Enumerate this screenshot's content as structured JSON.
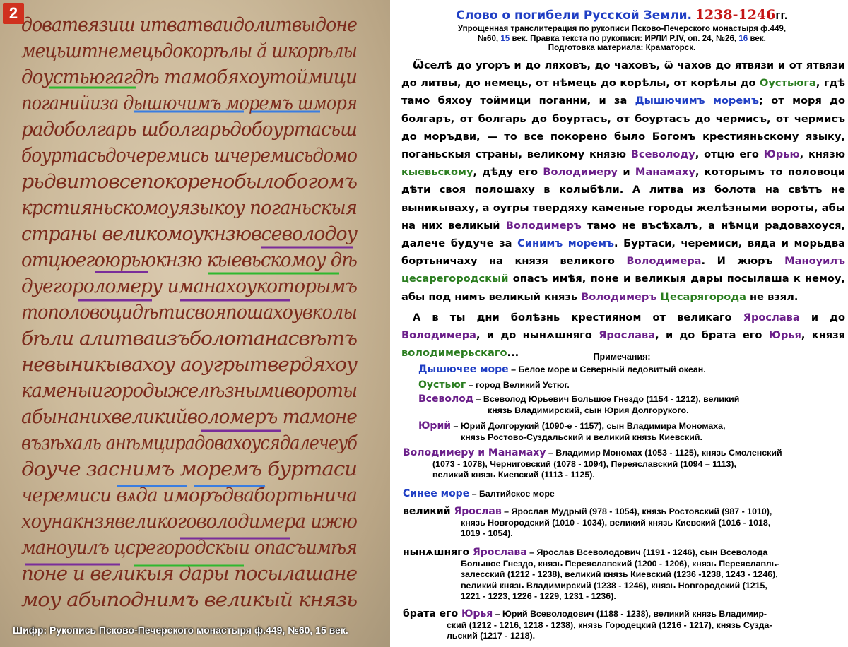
{
  "page_number": "2",
  "cipher": "Шифр: Рукопись Псково-Печерского монастыря ф.449, №60, 15 век.",
  "manuscript_lines": [
    "доватвязиш итватваидолитвыдоне",
    "мецьштнемецьдокорѣлы ӑ шкорѣлы",
    "доустьюгагдѣ тамобяхоутоймици",
    "поганийиза дышючимъ моремъ шморя",
    "радоболгарь шболгарьдобоуртасьш",
    "боуртасьдочеремись шчеремисьдомо",
    "рьдвитовсепокоренобылобогомъ",
    "крстияньскомоуязыкоу поганьскыя",
    "страны великомоукнзювсеволодоу",
    "отцюегоюрьюкнзю кыевьскомоу дѣ",
    "дуегороломеру иманахоукоторымъ",
    "тополовоцидѣтисвояпошахоувколы",
    "бѣли алитваизъболотанасвѣтъ",
    "невыникывахоу аоугрытвердяхоу",
    "каменыигородыжелѣзнымивороты",
    "абынанихвеликийволомеръ тамоне",
    "възѣхаль анѣмцирадовахоусядалечеуб",
    "доуче заснимъ моремъ буртаси",
    "черемиси вѧда иморъдвабортьнича",
    "хоунакнзявеликоговолодимера ижю",
    "маноуилъ цсрегородскыи опасъимѣя",
    "поне и великыя дары посылашане",
    "моу абыподнимъ великый князь",
    ""
  ],
  "title": {
    "main": "Слово о погибели Русской Земли.",
    "years": "1238-1246",
    "suffix": "гг."
  },
  "subtitle": {
    "line1": "Упрощенная транслитерация по рукописи Псково-Печерского монастыря ф.449,",
    "l2_a": "№60, ",
    "l2_b": "15",
    "l2_c": " век. Правка текста по рукописи: ИРЛИ P.IV, оп. 24, №26, ",
    "l2_d": "16",
    "l2_e": " век.",
    "line3": "Подготовка материала: Краматорск."
  },
  "body": {
    "p1_a": "Ѿселѣ до угоръ и до ляховъ, до чаховъ, ѿ чахов до ятвязи и от ятвязи до литвы, до немець, от нѣмець до корѣлы, от корѣлы до ",
    "p1_ustyug": "Оустьюга",
    "p1_b": ", гдѣ тамо бяхоу тоймици поганни, и за ",
    "p1_dysh": "Дышючимъ моремъ",
    "p1_c": "; от моря до болгаръ, от болгарь до боуртасъ, от боуртасъ до чермисъ, от чермисъ до моръдви, — то все покорено было Богомъ крестияньскому языку, поганьскыя страны, великому князю ",
    "p1_vsevolod": "Всеволоду",
    "p1_d": ", отцю его ",
    "p1_yuryu": "Юрью",
    "p1_e": ", князю ",
    "p1_kiev": "кыевьскому",
    "p1_f": ", дѣду его ",
    "p1_volodimeru": "Володимеру",
    "p1_g": " и ",
    "p1_manamahu": "Манамаху",
    "p1_h": ", которымъ то половоци дѣти своя полошаху в колыбѣли. А литва из болота на свѣтъ не выникываху, а оугры твердяху каменые городы желѣзными вороты, абы на них великый ",
    "p1_volodimer": "Володимеръ",
    "p1_i": " тамо не въсѣхалъ, а нѣмци радовахоуся, далече будуче за ",
    "p1_sinim": "Синимъ моремъ",
    "p1_j": ". Буртаси, черемиси, вяда и морьдва бортьничаху на князя великого ",
    "p1_volodimera": "Володимера",
    "p1_k": ". И жюръ ",
    "p1_manuil": "Маноуилъ",
    "p1_l": " ",
    "p1_tsar": "цесарегородскый",
    "p1_m": " опасъ имѣя, поне и великыя дары посылаша к немоу, абы под нимъ великый князь ",
    "p1_volodimer2": "Володимеръ",
    "p1_n": " ",
    "p1_tsar2": "Цесарягорода",
    "p1_o": " не взял.",
    "p2_a": "А в ты дни болѣзнь крестияном от великаго ",
    "p2_yaroslav": "Ярослава",
    "p2_b": " и до ",
    "p2_volodimera": "Володимера",
    "p2_c": ", и до нынѧшняго ",
    "p2_yaroslava": "Ярослава",
    "p2_d": ", и до брата его ",
    "p2_yurya": "Юрья",
    "p2_e": ", князя ",
    "p2_volodim": "володимерьскаго",
    "p2_f": "..."
  },
  "notes_title": "Примечания:",
  "notes": {
    "n1_term": "Дышючее море",
    "n1_text": " – Белое море и Северный ледовитый океан.",
    "n2_term": "Оустьюг",
    "n2_text": " – город Великий Устюг.",
    "n3_term": "Всеволод",
    "n3_text": " – Всеволод Юрьевич Большое Гнездо (1154 - 1212), великий",
    "n3_cont": "князь Владимирский, сын Юрия Долгорукого.",
    "n4_term": "Юрий",
    "n4_text": " – Юрий Долгорукий (1090-е - 1157), сын Владимира Мономаха,",
    "n4_cont": "князь Ростово-Суздальский и великий князь Киевский.",
    "n5_term": "Володимеру и Манамаху",
    "n5_text": " – Владимир Мономах (1053 - 1125), князь Смоленский",
    "n5_cont1": "(1073 - 1078), Черниговский (1078 - 1094), Переяславский (1094 – 1113),",
    "n5_cont2": "великий князь Киевский (1113 - 1125).",
    "n6_term": "Синее море",
    "n6_text": " – Балтийское море",
    "n7_term_a": "великий ",
    "n7_term_b": "Ярослав",
    "n7_text": " – Ярослав Мудрый (978 - 1054), князь Ростовский (987 - 1010),",
    "n7_cont1": "князь Новгородский (1010 - 1034), великий князь  Киевский (1016 - 1018,",
    "n7_cont2": "1019 - 1054).",
    "n8_term_a": "нынѧшняго ",
    "n8_term_b": "Ярослава",
    "n8_text": " – Ярослав Всеволодович (1191 - 1246), сын Всеволода",
    "n8_cont1": "Большое Гнездо, князь Переяславский (1200 - 1206), князь Переяславль-",
    "n8_cont2": "залесский (1212 - 1238), великий князь Киевский (1236 -1238, 1243 - 1246),",
    "n8_cont3": "великий князь Владимирский (1238 - 1246), князь Новгородский (1215,",
    "n8_cont4": "1221 - 1223, 1226 - 1229, 1231 - 1236).",
    "n9_term_a": "брата его ",
    "n9_term_b": "Юрья",
    "n9_text": " – Юрий Всеволодович (1188 - 1238), великий князь Владимир-",
    "n9_cont1": "ский (1212 - 1216, 1218 - 1238), князь Городецкий (1216 - 1217), князь Сузда-",
    "n9_cont2": "льский (1217 - 1218)."
  },
  "colors": {
    "blue": "#1f3ec4",
    "green": "#2a7d1f",
    "purple": "#6b1f8a",
    "red": "#c41414",
    "ink": "#7b2b1c",
    "parchment": "#cdbb9c"
  }
}
